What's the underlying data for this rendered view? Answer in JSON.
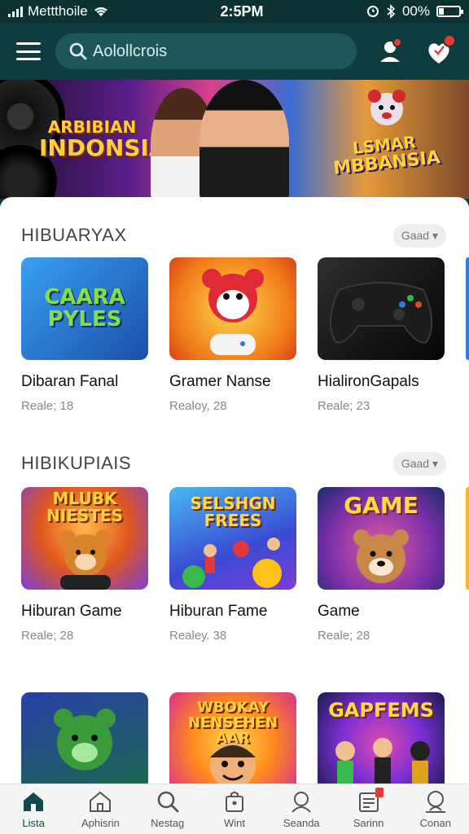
{
  "status_bar": {
    "carrier": "Mettthoile",
    "time": "2:5PM",
    "battery": "00%"
  },
  "header": {
    "search_placeholder": "Aolollcrois",
    "icons": [
      "menu-icon",
      "search-icon",
      "profile-icon",
      "notification-icon"
    ]
  },
  "banner": {
    "left_title_line1": "ARBIBIAN",
    "left_title_line2": "INDONSIA",
    "right_title_line1": "LSMAR",
    "right_title_line2": "MBBANSIA"
  },
  "sections": [
    {
      "title": "HIBUARYAX",
      "chip": "Gaad",
      "cards": [
        {
          "title": "Dibaran Fanal",
          "meta": "Reale; 18",
          "thumb_text": "CAARA PYLES",
          "thumb_colors": [
            "#2f7fe0",
            "#1a4fa8"
          ]
        },
        {
          "title": "Gramer Nanse",
          "meta": "Realoy, 28",
          "thumb_text": "",
          "thumb_colors": [
            "#ffb02e",
            "#e8521a"
          ]
        },
        {
          "title": "HialironGapals",
          "meta": "Reale; 23",
          "thumb_text": "",
          "thumb_colors": [
            "#2a2a2a",
            "#0a0a0a"
          ]
        }
      ]
    },
    {
      "title": "HIBIKUPIAIS",
      "chip": "Gaad",
      "cards": [
        {
          "title": "Hiburan Game",
          "meta": "Reale; 28",
          "thumb_text": "MLUBK NIESTES",
          "thumb_colors": [
            "#7a3fd4",
            "#e0571e"
          ]
        },
        {
          "title": "Hiburan Fame",
          "meta": "Realeу. 38",
          "thumb_text": "SELSHGN FREES",
          "thumb_colors": [
            "#3fa8e8",
            "#7a3fd4"
          ]
        },
        {
          "title": "Game",
          "meta": "Reale; 28",
          "thumb_text": "GAME",
          "thumb_colors": [
            "#c2307a",
            "#2a3fa8"
          ]
        }
      ]
    },
    {
      "title": "",
      "chip": "",
      "cards": [
        {
          "title": "",
          "meta": "",
          "thumb_text": "",
          "thumb_colors": [
            "#1a4fa8",
            "#2a8a4a"
          ]
        },
        {
          "title": "",
          "meta": "",
          "thumb_text": "WBOKAY NENSEHEN AAR",
          "thumb_colors": [
            "#ff8a1e",
            "#d8318e"
          ]
        },
        {
          "title": "",
          "meta": "",
          "thumb_text": "GAPFEMS",
          "thumb_colors": [
            "#7a2fd4",
            "#1a1a4a"
          ]
        }
      ]
    }
  ],
  "bottom_nav": [
    {
      "label": "Lista",
      "icon": "home-icon",
      "active": true
    },
    {
      "label": "Aphisrin",
      "icon": "house-outline-icon",
      "active": false
    },
    {
      "label": "Nestag",
      "icon": "search-icon",
      "active": false
    },
    {
      "label": "Wint",
      "icon": "bag-icon",
      "active": false
    },
    {
      "label": "Seanda",
      "icon": "person-icon",
      "active": false
    },
    {
      "label": "Sarinn",
      "icon": "calendar-icon",
      "active": false
    },
    {
      "label": "Conan",
      "icon": "profile-icon",
      "active": false
    }
  ],
  "colors": {
    "header_bg": "#0f3d3f",
    "search_bg": "#1e5759",
    "accent_red": "#e63b2e",
    "active_nav": "#0f4a4f"
  }
}
